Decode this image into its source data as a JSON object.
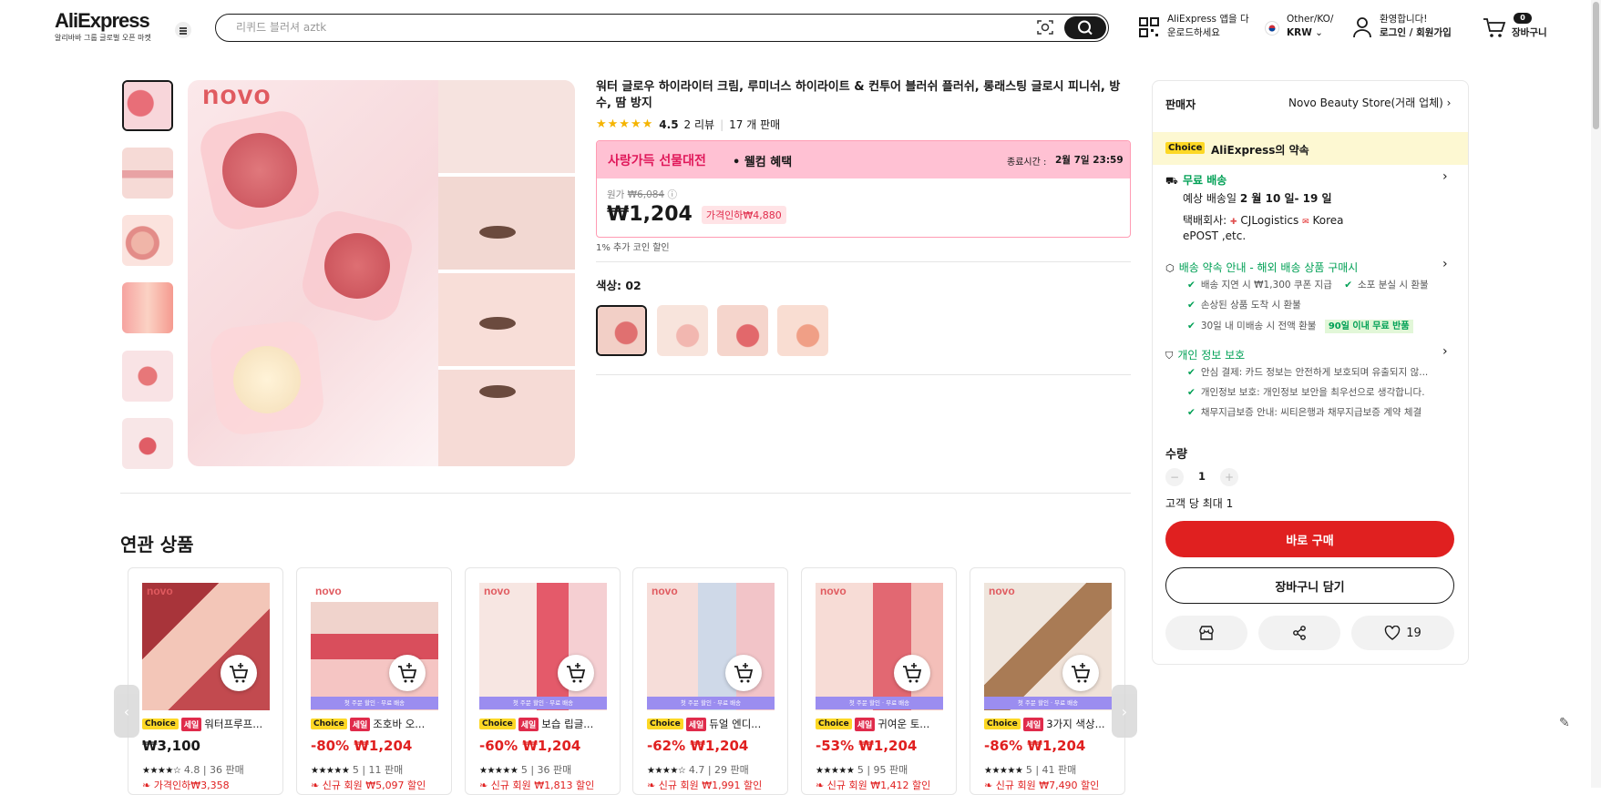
{
  "header": {
    "logo": "AliExpress",
    "logo_sub": "알리바바 그룹 글로벌 오픈 마켓",
    "search_placeholder": "리퀴드 블러셔 aztk",
    "app_line1": "AliExpress 앱을 다",
    "app_line2": "운로드하세요",
    "locale_line1": "Other/KO/",
    "locale_line2": "KRW",
    "account_line1": "환영합니다!",
    "account_line2": "로그인 / 회원가입",
    "cart_count": "0",
    "cart_label": "장바구니"
  },
  "product": {
    "title": "워터 글로우 하이라이터 크림, 루미너스 하이라이트 & 컨투어 블러쉬 플러쉬, 롱래스팅 글로시 피니쉬, 방수, 땀 방지",
    "rating": "4.5",
    "reviews": "2 리뷰",
    "sold": "17 개 판매",
    "promo_title": "사랑가득 선물대전",
    "promo_suffix": "• 웰컴 혜택",
    "end_label": "종료시간 :",
    "end_time": "2월 7일 23:59",
    "original_label": "원가",
    "original_price": "₩6,084",
    "price": "₩1,204",
    "discount_label": "가격인하₩4,880",
    "coin_note": "1% 추가 코인 할인",
    "color_label": "색상: 02",
    "image_brand": "novo"
  },
  "seller": {
    "label": "판매자",
    "name": "Novo Beauty Store(거래 업체)",
    "choice_tag": "Choice",
    "promise": "AliExpress의 약속",
    "free_shipping": "무료 배송",
    "delivery_prefix": "예상 배송일",
    "delivery_dates": "2 월 10 일- 19 일",
    "carrier_label": "택배회사:",
    "carrier1": "CJLogistics",
    "carrier2": "Korea",
    "carrier3": "ePOST ,etc.",
    "guarantee_title": "배송 약속 안내 - 해외 배송 상품 구매시",
    "guarantee_items": [
      "배송 지연 시 ₩1,300 쿠폰 지급",
      "소포 분실 시 환불",
      "손상된 상품 도착 시 환불",
      "30일 내 미배송 시 전액 환불"
    ],
    "return_badge": "90일 이내 무료 반품",
    "privacy_title": "개인 정보 보호",
    "privacy_items": [
      "안심 결제: 카드 정보는 안전하게 보호되며 유출되지 않...",
      "개인정보 보호: 개인정보 보안을 최우선으로 생각합니다.",
      "채무지급보증 안내: 씨티은행과 채무지급보증 계약 체결"
    ],
    "qty_label": "수량",
    "qty_value": "1",
    "qty_limit": "고객 당 최대 1",
    "buy_now": "바로 구매",
    "add_cart": "장바구니 담기",
    "wishlist_count": "19"
  },
  "related": {
    "title": "연관 상품",
    "banner_text": "첫 주문 할인 · 무료 배송",
    "items": [
      {
        "name": "워터프루프...",
        "price_discount": "",
        "price": "₩3,100",
        "stars": "★★★★☆",
        "rating": "4.8",
        "sold": "36 판매",
        "promo": "가격인하₩3,358",
        "brand": "novo"
      },
      {
        "name": "조호바 오...",
        "price_discount": "-80%",
        "price": "₩1,204",
        "stars": "★★★★★",
        "rating": "5",
        "sold": "11 판매",
        "promo": "신규 회원 ₩5,097 할인",
        "brand": "novo"
      },
      {
        "name": "보습 립글...",
        "price_discount": "-60%",
        "price": "₩1,204",
        "stars": "★★★★★",
        "rating": "5",
        "sold": "36 판매",
        "promo": "신규 회원 ₩1,813 할인",
        "brand": "novo"
      },
      {
        "name": "듀얼 엔디...",
        "price_discount": "-62%",
        "price": "₩1,204",
        "stars": "★★★★☆",
        "rating": "4.7",
        "sold": "29 판매",
        "promo": "신규 회원 ₩1,991 할인",
        "brand": "novo"
      },
      {
        "name": "귀여운 토...",
        "price_discount": "-53%",
        "price": "₩1,204",
        "stars": "★★★★★",
        "rating": "5",
        "sold": "95 판매",
        "promo": "신규 회원 ₩1,412 할인",
        "brand": "novo"
      },
      {
        "name": "3가지 색상...",
        "price_discount": "-86%",
        "price": "₩1,204",
        "stars": "★★★★★",
        "rating": "5",
        "sold": "41 판매",
        "promo": "신규 회원 ₩7,490 할인",
        "brand": "novo"
      }
    ],
    "tag_choice": "Choice",
    "tag_sale": "세일"
  },
  "colors": {
    "accent": "#e02020",
    "choice_yellow": "#fdd825",
    "green": "#00a055",
    "promo_pink": "#ffc1d3"
  }
}
